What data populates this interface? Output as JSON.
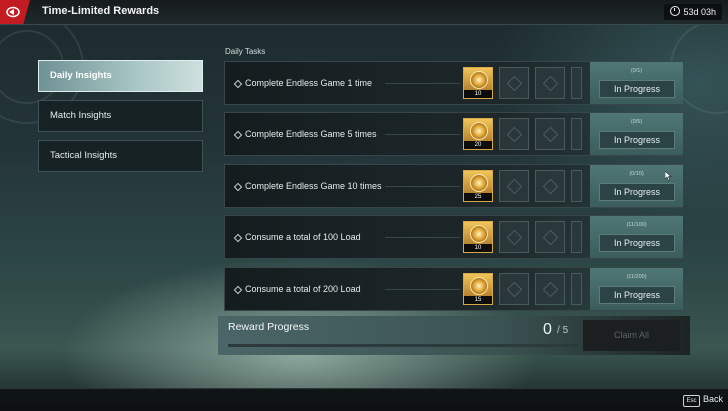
{
  "header": {
    "title": "Time-Limited Rewards",
    "timer": "53d 03h"
  },
  "sidebar": {
    "tabs": [
      {
        "label": "Daily Insights",
        "active": true
      },
      {
        "label": "Match Insights",
        "active": false
      },
      {
        "label": "Tactical Insights",
        "active": false
      }
    ]
  },
  "section_label": "Daily Tasks",
  "tasks": [
    {
      "name": "Complete Endless Game 1 time",
      "reward_qty": "10",
      "count": "(0/1)",
      "status": "In Progress"
    },
    {
      "name": "Complete Endless Game 5 times",
      "reward_qty": "20",
      "count": "(0/5)",
      "status": "In Progress"
    },
    {
      "name": "Complete Endless Game 10 times",
      "reward_qty": "25",
      "count": "(0/10)",
      "status": "In Progress"
    },
    {
      "name": "Consume a total of 100 Load",
      "reward_qty": "10",
      "count": "(11/100)",
      "status": "In Progress"
    },
    {
      "name": "Consume a total of 200 Load",
      "reward_qty": "15",
      "count": "(11/200)",
      "status": "In Progress"
    }
  ],
  "reward_progress": {
    "title": "Reward Progress",
    "current": "0",
    "total": "5",
    "claim_label": "Claim All"
  },
  "footer": {
    "key": "Esc",
    "label": "Back"
  },
  "colors": {
    "accent_red": "#c21c22",
    "panel_teal": "#4f7775",
    "reward_gold": "#e0a636"
  }
}
